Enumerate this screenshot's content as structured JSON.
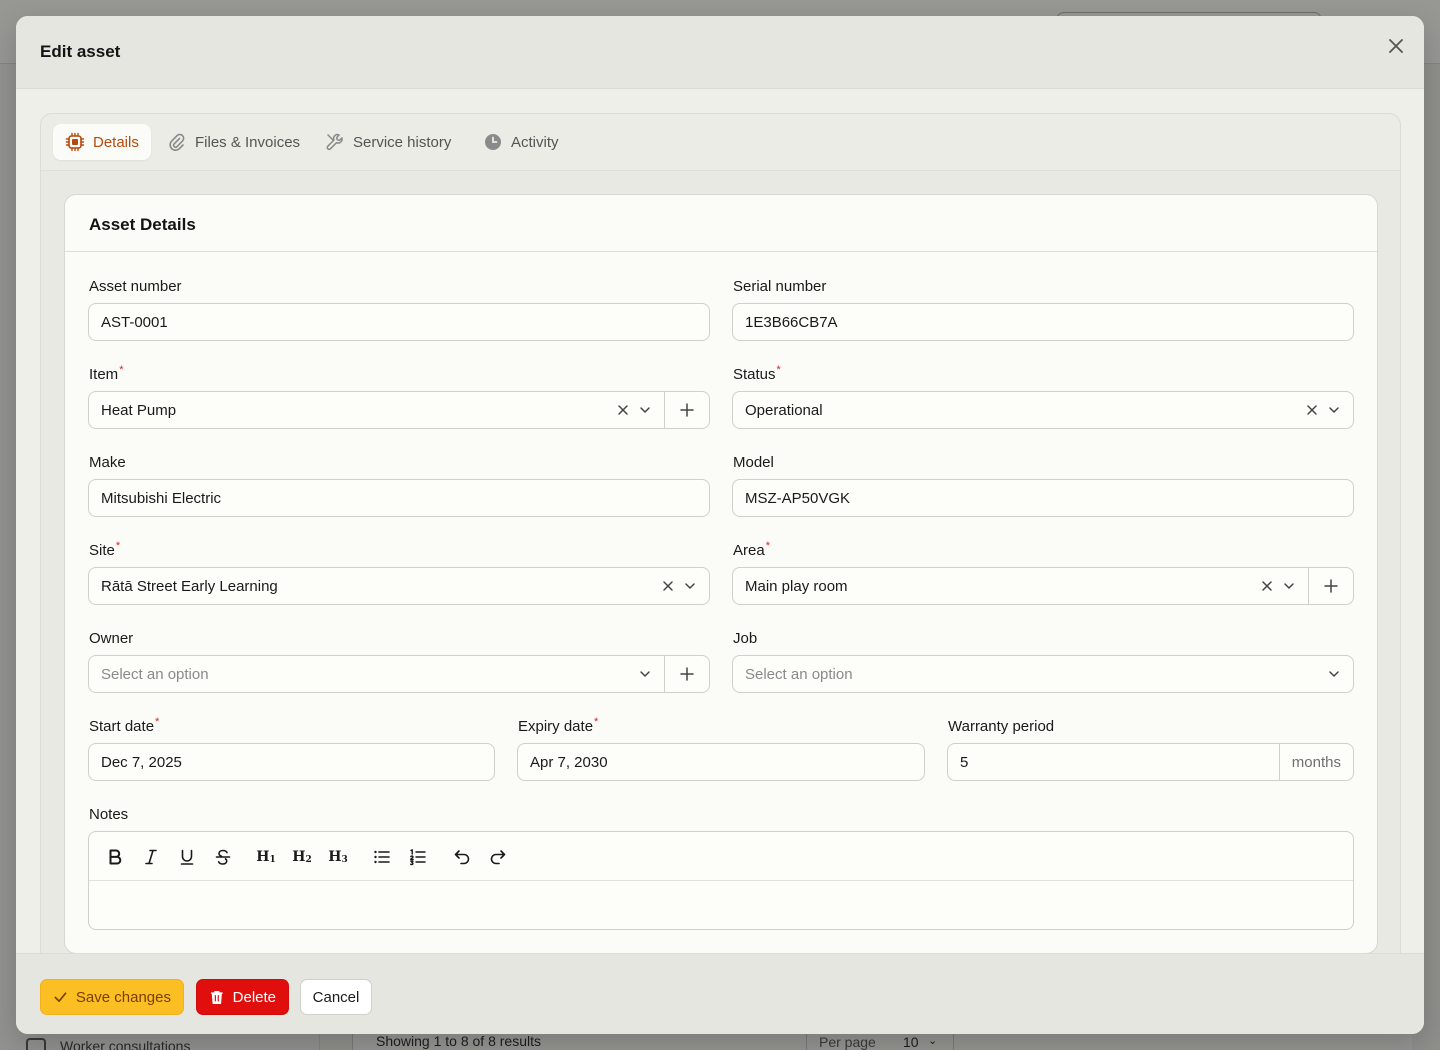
{
  "background": {
    "sidebar_item": "Worker consultations",
    "showing": "Showing 1 to 8 of 8 results",
    "per_page_label": "Per page",
    "per_page_value": "10"
  },
  "modal": {
    "title": "Edit asset"
  },
  "tabs": [
    {
      "label": "Details",
      "icon": "chip-icon",
      "active": true
    },
    {
      "label": "Files & Invoices",
      "icon": "paperclip-icon",
      "active": false
    },
    {
      "label": "Service history",
      "icon": "wrench-icon",
      "active": false
    },
    {
      "label": "Activity",
      "icon": "clock-icon",
      "active": false
    }
  ],
  "section": {
    "title": "Asset Details"
  },
  "fields": {
    "asset_number": {
      "label": "Asset number",
      "value": "AST-0001"
    },
    "serial_number": {
      "label": "Serial number",
      "value": "1E3B66CB7A"
    },
    "item": {
      "label": "Item",
      "value": "Heat Pump",
      "required": "*"
    },
    "status": {
      "label": "Status",
      "value": "Operational",
      "required": "*"
    },
    "make": {
      "label": "Make",
      "value": "Mitsubishi Electric"
    },
    "model": {
      "label": "Model",
      "value": "MSZ-AP50VGK"
    },
    "site": {
      "label": "Site",
      "value": "Rātā Street Early Learning",
      "required": "*"
    },
    "area": {
      "label": "Area",
      "value": "Main play room",
      "required": "*"
    },
    "owner": {
      "label": "Owner",
      "placeholder": "Select an option"
    },
    "job": {
      "label": "Job",
      "placeholder": "Select an option"
    },
    "start_date": {
      "label": "Start date",
      "value": "Dec 7, 2025",
      "required": "*"
    },
    "expiry_date": {
      "label": "Expiry date",
      "value": "Apr 7, 2030",
      "required": "*"
    },
    "warranty_period": {
      "label": "Warranty period",
      "value": "5",
      "suffix": "months"
    },
    "notes": {
      "label": "Notes",
      "value": ""
    }
  },
  "editor_toolbar": [
    "bold-icon",
    "italic-icon",
    "underline-icon",
    "strikethrough-icon",
    "heading-1-icon",
    "heading-2-icon",
    "heading-3-icon",
    "bullet-list-icon",
    "ordered-list-icon",
    "undo-icon",
    "redo-icon"
  ],
  "footer": {
    "save_label": "Save changes",
    "delete_label": "Delete",
    "cancel_label": "Cancel"
  },
  "colors": {
    "accent_tab": "#b44a10",
    "save_button": "#fbbf24",
    "delete_button": "#e10e0e",
    "required_marker": "#e01e1e"
  }
}
